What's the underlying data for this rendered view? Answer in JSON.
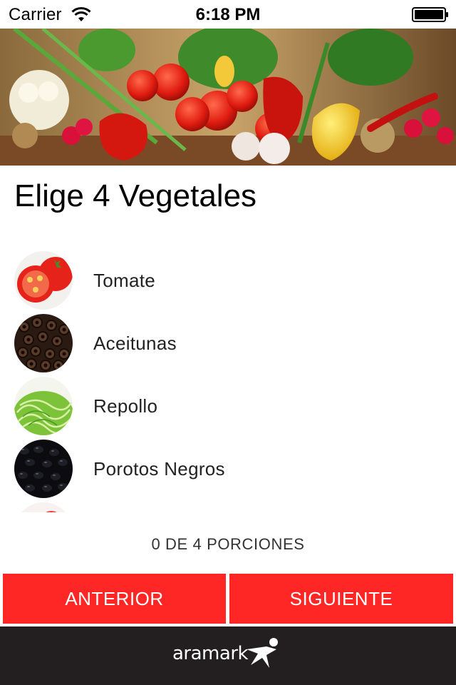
{
  "status_bar": {
    "carrier": "Carrier",
    "time": "6:18 PM",
    "wifi_icon": "wifi-icon",
    "battery_icon": "battery-icon"
  },
  "hero": {
    "image": "vegetables-banner",
    "description": "fresh vegetables photo"
  },
  "title": "Elige 4 Vegetales",
  "items": [
    {
      "label": "Tomate",
      "icon": "tomato-thumbnail"
    },
    {
      "label": "Aceitunas",
      "icon": "olives-thumbnail"
    },
    {
      "label": "Repollo",
      "icon": "cabbage-thumbnail"
    },
    {
      "label": "Porotos Negros",
      "icon": "black-beans-thumbnail"
    }
  ],
  "portions": "0 DE 4 PORCIONES",
  "buttons": {
    "previous": "ANTERIOR",
    "next": "SIGUIENTE"
  },
  "footer": {
    "brand": "aramark"
  },
  "colors": {
    "accent": "#fe2726",
    "footer_bg": "#231f20",
    "text": "#222222"
  }
}
